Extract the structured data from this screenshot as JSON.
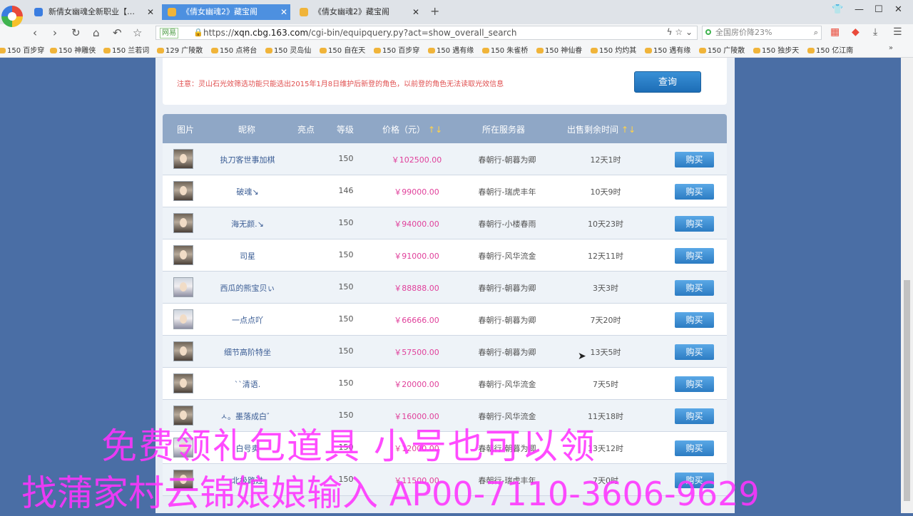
{
  "tabs": [
    {
      "label": "新倩女幽魂全新职业【吟溯】上",
      "active": false,
      "color": "#3a7de0"
    },
    {
      "label": "《倩女幽魂2》藏宝阁",
      "active": true,
      "color": "#f0b43a"
    },
    {
      "label": "《倩女幽魂2》藏宝阁",
      "active": false,
      "color": "#f0b43a"
    }
  ],
  "address": {
    "badge": "网易",
    "url_scheme": "https://",
    "url_host": "xqn.cbg.163.com",
    "url_path": "/cgi-bin/equipquery.py?act=show_overall_search"
  },
  "search": {
    "placeholder": "全国房价降23%"
  },
  "bookmarks": [
    "150 百步穿",
    "150 神雕侠",
    "150 兰若词",
    "129 广陵散",
    "150 点将台",
    "150 灵岛仙",
    "150 自在天",
    "150 百步穿",
    "150 遇有缘",
    "150 朱雀桥",
    "150 神仙眷",
    "150 灼灼其",
    "150 遇有缘",
    "150 广陵散",
    "150 独步天",
    "150 亿江南"
  ],
  "notice": "注意：灵山石光效筛选功能只能选出2015年1月8日维护后新登的角色，以前登的角色无法读取光效信息",
  "query_label": "查询",
  "table": {
    "headers": {
      "image": "图片",
      "nick": "昵称",
      "highlight": "亮点",
      "level": "等级",
      "price": "价格（元）",
      "server": "所在服务器",
      "remaining": "出售剩余时间"
    },
    "sort_arrows": "↑↓",
    "buy_label": "购买",
    "rows": [
      {
        "nick": "执刀客世事加棋",
        "level": "150",
        "price": "￥102500.00",
        "server": "春朝行-朝暮为卿",
        "remaining": "12天1时",
        "avatar": "dark"
      },
      {
        "nick": "破魂↘",
        "level": "146",
        "price": "￥99000.00",
        "server": "春朝行-瑞虎丰年",
        "remaining": "10天9时",
        "avatar": "dark"
      },
      {
        "nick": "海无颜.↘",
        "level": "150",
        "price": "￥94000.00",
        "server": "春朝行-小楼春雨",
        "remaining": "10天23时",
        "avatar": "dark"
      },
      {
        "nick": "司星",
        "level": "150",
        "price": "￥91000.00",
        "server": "春朝行-风华流金",
        "remaining": "12天11时",
        "avatar": "dark"
      },
      {
        "nick": "西瓜的熊宝贝ぃ",
        "level": "150",
        "price": "￥88888.00",
        "server": "春朝行-朝暮为卿",
        "remaining": "3天3时",
        "avatar": "white"
      },
      {
        "nick": "一点点吖",
        "level": "150",
        "price": "￥66666.00",
        "server": "春朝行-朝暮为卿",
        "remaining": "7天20时",
        "avatar": "white"
      },
      {
        "nick": "细节高阶特坐",
        "level": "150",
        "price": "￥57500.00",
        "server": "春朝行-朝暮为卿",
        "remaining": "13天5时",
        "avatar": "dark"
      },
      {
        "nick": "``清语.",
        "level": "150",
        "price": "￥20000.00",
        "server": "春朝行-风华流金",
        "remaining": "7天5时",
        "avatar": "dark"
      },
      {
        "nick": "ㅅ。墨落成白゛",
        "level": "150",
        "price": "￥16000.00",
        "server": "春朝行-风华流金",
        "remaining": "11天18时",
        "avatar": "dark"
      },
      {
        "nick": "白号卖",
        "level": "150",
        "price": "￥12000.00",
        "server": "春朝行-朝暮为卿",
        "remaining": "13天12时",
        "avatar": "white"
      },
      {
        "nick": "北极路过",
        "level": "150",
        "price": "￥11500.00",
        "server": "春朝行-瑞虎丰年",
        "remaining": "7天0时",
        "avatar": "dark"
      }
    ]
  },
  "overlay": {
    "line1": "免费领礼包道具 小号也可以领",
    "line2_text": "找蒲家村云锦娘娘输入 ",
    "line2_code": "AP00-7110-3606-9629"
  },
  "colors": {
    "accent": "#4d90e0",
    "price": "#e0409b",
    "overlay": "#ff33ff",
    "header": "#8fa7c6"
  }
}
